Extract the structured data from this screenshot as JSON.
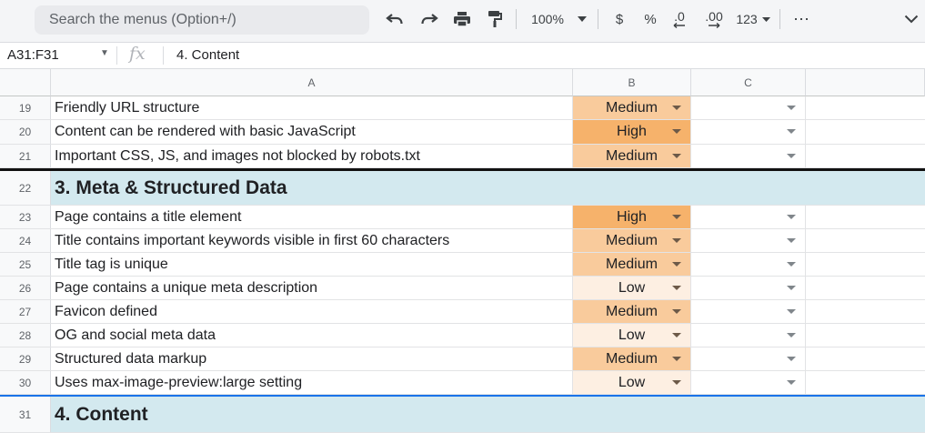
{
  "toolbar": {
    "search_placeholder": "Search the menus (Option+/)",
    "zoom": "100%",
    "currency": "$",
    "percent": "%",
    "decrease_decimals": ".0",
    "increase_decimals": ".00",
    "more_formats": "123",
    "more": "⋯",
    "icons": [
      "undo-icon",
      "redo-icon",
      "print-icon",
      "paint-format-icon",
      "chevron-down-icon"
    ]
  },
  "formula_bar": {
    "name_box": "A31:F31",
    "fx": "fx",
    "formula": "4. Content"
  },
  "columns": [
    "A",
    "B",
    "C"
  ],
  "rows": [
    {
      "num": "19",
      "text": "Friendly URL structure",
      "priority": "Medium",
      "color": "#f9cb9c",
      "type": "item"
    },
    {
      "num": "20",
      "text": "Content can be rendered with basic JavaScript",
      "priority": "High",
      "color": "#f6b26b",
      "type": "item"
    },
    {
      "num": "21",
      "text": "Important CSS, JS, and images not blocked by robots.txt",
      "priority": "Medium",
      "color": "#f9cb9c",
      "type": "item"
    },
    {
      "num": "22",
      "text": "3. Meta & Structured Data",
      "type": "section"
    },
    {
      "num": "23",
      "text": "Page contains a title element",
      "priority": "High",
      "color": "#f6b26b",
      "type": "item"
    },
    {
      "num": "24",
      "text": "Title contains important keywords visible in first 60 characters",
      "priority": "Medium",
      "color": "#f9cb9c",
      "type": "item"
    },
    {
      "num": "25",
      "text": "Title tag is unique",
      "priority": "Medium",
      "color": "#f9cb9c",
      "type": "item"
    },
    {
      "num": "26",
      "text": "Page contains a unique meta description",
      "priority": "Low",
      "color": "#fdefe2",
      "type": "item"
    },
    {
      "num": "27",
      "text": "Favicon defined",
      "priority": "Medium",
      "color": "#f9cb9c",
      "type": "item"
    },
    {
      "num": "28",
      "text": "OG and social meta data",
      "priority": "Low",
      "color": "#fdefe2",
      "type": "item"
    },
    {
      "num": "29",
      "text": "Structured data markup",
      "priority": "Medium",
      "color": "#f9cb9c",
      "type": "item"
    },
    {
      "num": "30",
      "text": "Uses max-image-preview:large setting",
      "priority": "Low",
      "color": "#fdefe2",
      "type": "item"
    },
    {
      "num": "31",
      "text": "4. Content",
      "type": "section"
    }
  ],
  "colors": {
    "high": "#f6b26b",
    "medium": "#f9cb9c",
    "low": "#fdefe2",
    "section_fill": "#d3e9ef",
    "selection": "#1a73e8"
  }
}
